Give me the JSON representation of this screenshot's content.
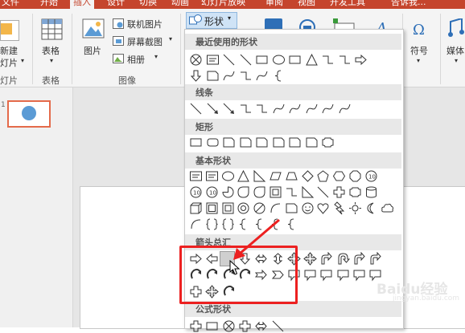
{
  "tabs": [
    {
      "label": "文件",
      "active": false
    },
    {
      "label": "开始",
      "active": false
    },
    {
      "label": "插入",
      "active": true
    },
    {
      "label": "设计",
      "active": false
    },
    {
      "label": "切换",
      "active": false
    },
    {
      "label": "动画",
      "active": false
    },
    {
      "label": "幻灯片放映",
      "active": false
    },
    {
      "label": "审阅",
      "active": false
    },
    {
      "label": "视图",
      "active": false
    },
    {
      "label": "开发工具",
      "active": false
    },
    {
      "label": "告诉我...",
      "active": false
    }
  ],
  "ribbon": {
    "new_slide": {
      "line1": "新建",
      "line2": "灯片"
    },
    "table": "表格",
    "image": "图片",
    "online_picture": "联机图片",
    "screenshot": "屏幕截图",
    "album": "相册",
    "shapes": "形状",
    "symbol": "符号",
    "media": "媒体",
    "groups": {
      "slides": "幻灯片",
      "table": "表格",
      "images": "图像"
    }
  },
  "slides_pane": {
    "slide_number": "1"
  },
  "shapes_menu": {
    "sections": {
      "recent": "最近使用的形状",
      "lines": "线条",
      "rectangles": "矩形",
      "basic": "基本形状",
      "block_arrows": "箭头总汇",
      "equations": "公式形状"
    }
  },
  "watermark": {
    "main": "Baidu经验",
    "sub": "jingyan.baidu.com"
  },
  "colors": {
    "accent": "#c5452d",
    "highlight": "#ec2020",
    "panel_header": "#e8e8e8"
  }
}
